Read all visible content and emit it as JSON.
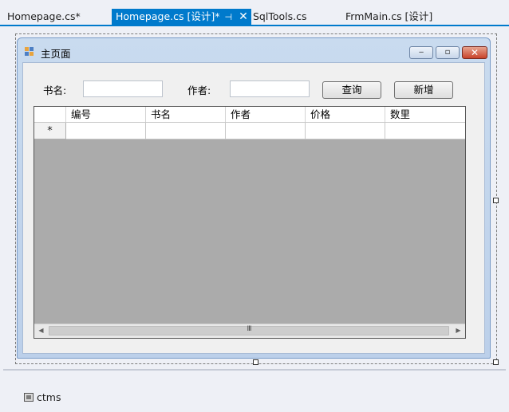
{
  "tabs": [
    {
      "label": "Homepage.cs*",
      "active": false
    },
    {
      "label": "Homepage.cs [设计]*",
      "active": true
    },
    {
      "label": "SqlTools.cs",
      "active": false
    },
    {
      "label": "FrmMain.cs [设计]",
      "active": false
    }
  ],
  "form": {
    "title": "主页面",
    "search": {
      "book_label": "书名:",
      "book_value": "",
      "author_label": "作者:",
      "author_value": "",
      "query_button": "查询",
      "add_button": "新增"
    },
    "grid": {
      "columns": [
        "编号",
        "书名",
        "作者",
        "价格",
        "数里"
      ],
      "new_row_marker": "*",
      "scroll_grip": "III"
    }
  },
  "caption_buttons": {
    "minimize": "‒",
    "maximize": "▫",
    "close": "✕"
  },
  "tray": {
    "component_label": "ctms"
  },
  "colors": {
    "accent": "#007acc",
    "grid_background": "#ababab"
  }
}
